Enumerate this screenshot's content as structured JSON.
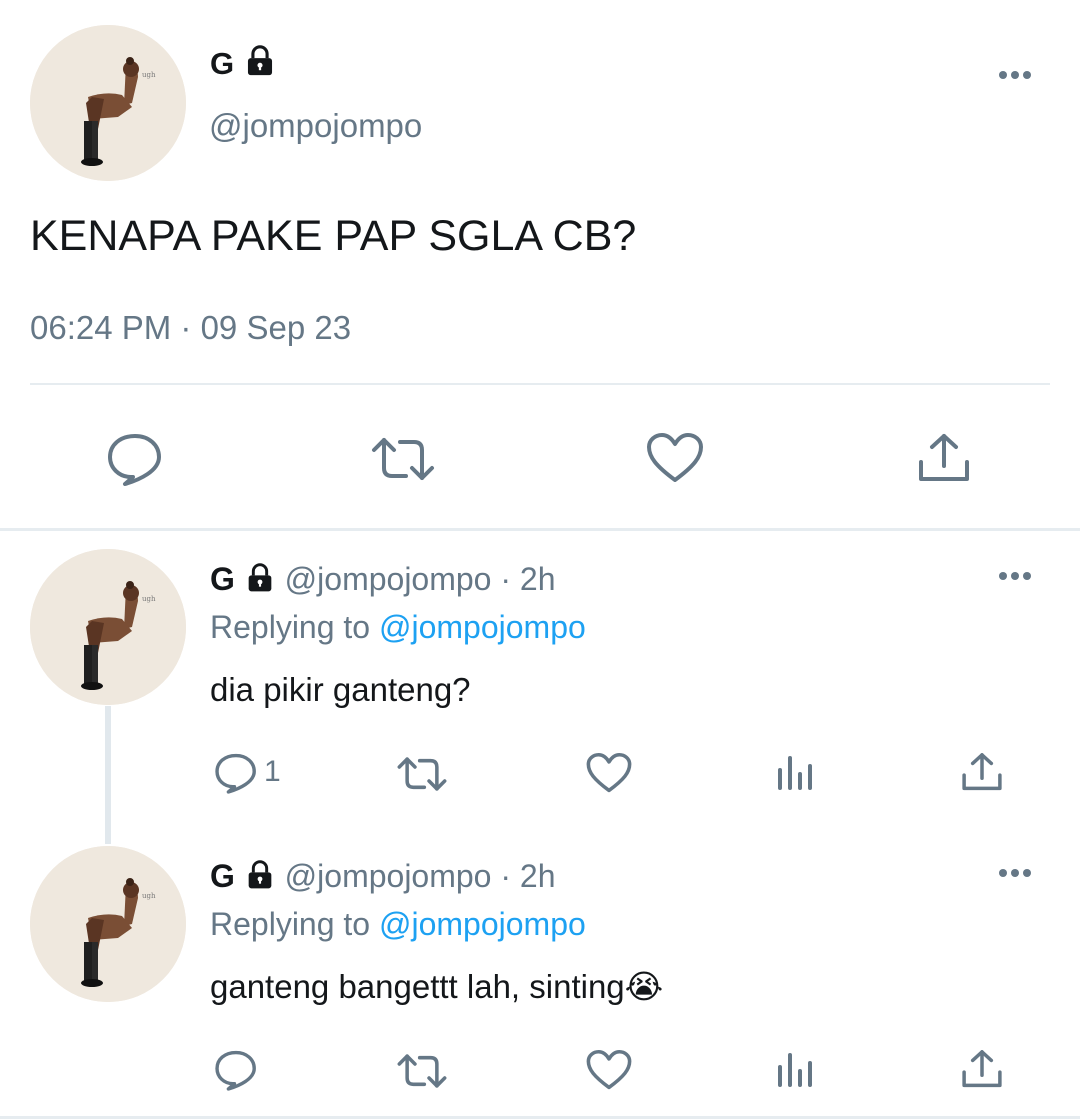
{
  "main_tweet": {
    "name": "G",
    "handle": "@jompojompo",
    "text": "KENAPA PAKE PAP SGLA CB?",
    "timestamp": "06:24 PM · 09 Sep 23"
  },
  "replies": [
    {
      "name": "G",
      "handle_time": "@jompojompo · 2h",
      "replying_prefix": "Replying to",
      "replying_to": "@jompojompo",
      "text": "dia pikir ganteng?",
      "reply_count": "1"
    },
    {
      "name": "G",
      "handle_time": "@jompojompo · 2h",
      "replying_prefix": "Replying to",
      "replying_to": "@jompojompo",
      "text": "ganteng bangettt lah, sinting",
      "emoji": "😭",
      "reply_count": ""
    }
  ],
  "colors": {
    "accent": "#1da1f2",
    "secondary_text": "#657786",
    "divider": "#e6ecf0"
  },
  "icons": [
    "lock-icon",
    "more-icon",
    "reply-icon",
    "retweet-icon",
    "like-icon",
    "share-icon",
    "analytics-icon"
  ]
}
